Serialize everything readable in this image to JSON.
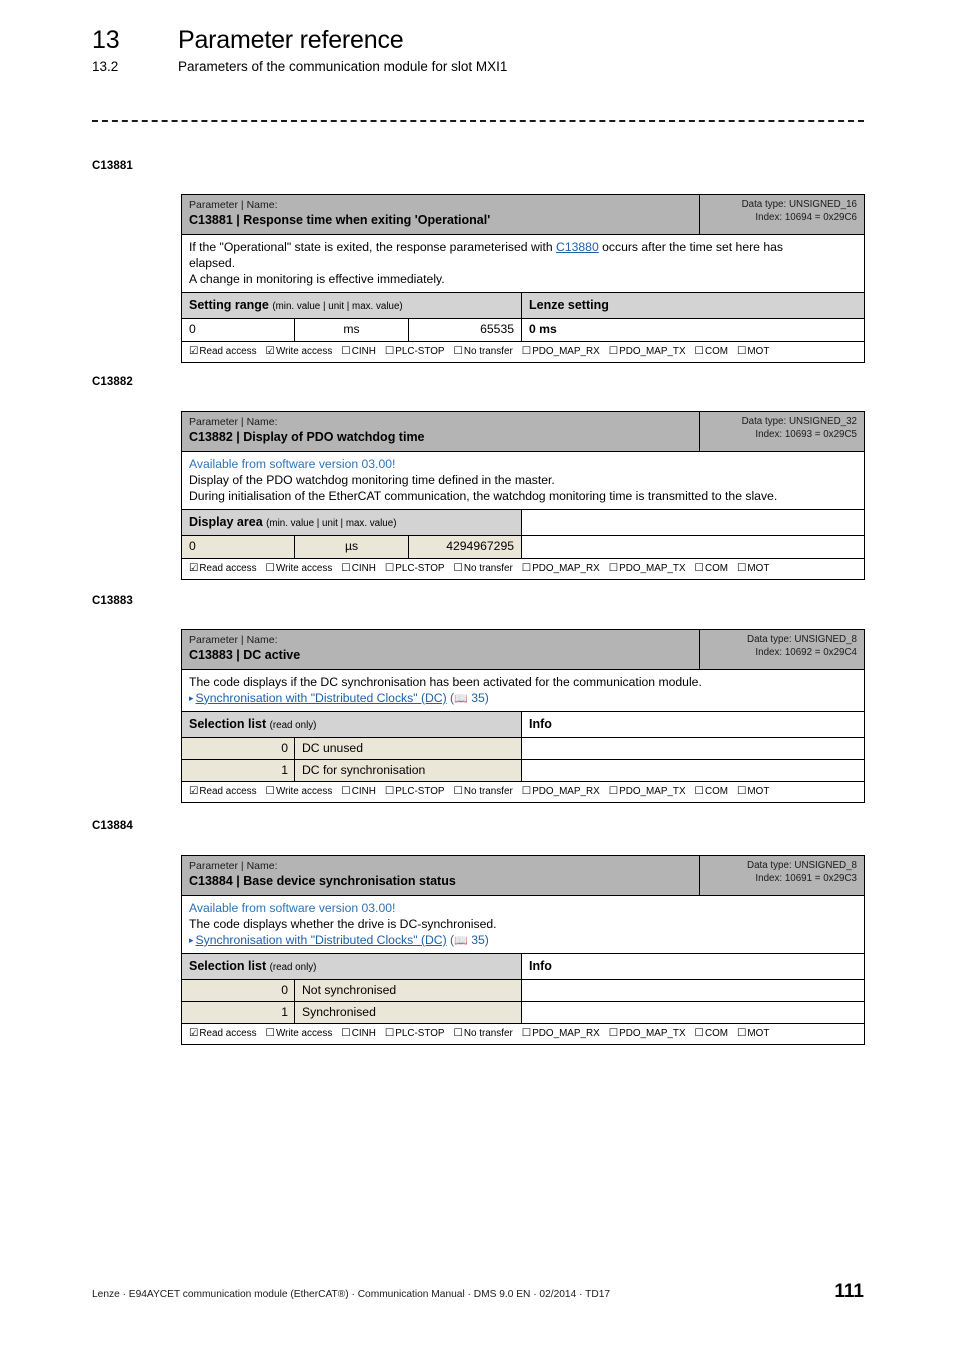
{
  "header": {
    "chapter_number": "13",
    "chapter_title": "Parameter reference",
    "section_number": "13.2",
    "section_title": "Parameters of the communication module for slot MXI1"
  },
  "flag_labels": {
    "read": "Read access",
    "write": "Write access",
    "cinh": "CINH",
    "plc_stop": "PLC-STOP",
    "no_transfer": "No transfer",
    "pdo_map_rx": "PDO_MAP_RX",
    "pdo_map_tx": "PDO_MAP_TX",
    "com": "COM",
    "mot": "MOT"
  },
  "checkbox_glyphs": {
    "checked": "☑",
    "unchecked": "☐"
  },
  "params": [
    {
      "code": "C13881",
      "title_kicker": "Parameter | Name:",
      "title_main": "C13881 | Response time when exiting 'Operational'",
      "data_type": "Data type: UNSIGNED_16",
      "index": "Index: 10694 = 0x29C6",
      "desc_line1_a": "If the \"Operational\" state is exited, the response parameterised with ",
      "desc_link": "C13880",
      "desc_line1_b": " occurs after the time set here has",
      "desc_line2": "elapsed.",
      "desc_line3": "A change in monitoring is effective immediately.",
      "range_head_left_bold": "Setting range ",
      "range_head_left_small": "(min. value | unit | max. value)",
      "range_head_right": "Lenze setting",
      "range_min": "0",
      "range_unit": "ms",
      "range_max": "65535",
      "lenze_setting": "0 ms",
      "flags": {
        "read": "☑",
        "write": "☑",
        "cinh": "☐",
        "plc_stop": "☐",
        "no_transfer": "☐",
        "pdo_map_rx": "☐",
        "pdo_map_tx": "☐",
        "com": "☐",
        "mot": "☐"
      }
    },
    {
      "code": "C13882",
      "title_kicker": "Parameter | Name:",
      "title_main": "C13882 | Display of PDO watchdog time",
      "data_type": "Data type: UNSIGNED_32",
      "index": "Index: 10693 = 0x29C5",
      "sw_note": "Available from software version 03.00!",
      "desc_line2": "Display of the PDO watchdog monitoring time defined in the master.",
      "desc_line3": "During initialisation of the EtherCAT communication, the watchdog monitoring time is transmitted to the slave.",
      "range_head_left_bold": "Display area ",
      "range_head_left_small": "(min. value | unit | max. value)",
      "range_min": "0",
      "range_unit": "µs",
      "range_max": "4294967295",
      "flags": {
        "read": "☑",
        "write": "☐",
        "cinh": "☐",
        "plc_stop": "☐",
        "no_transfer": "☐",
        "pdo_map_rx": "☐",
        "pdo_map_tx": "☐",
        "com": "☐",
        "mot": "☐"
      }
    },
    {
      "code": "C13883",
      "title_kicker": "Parameter | Name:",
      "title_main": "C13883 | DC active",
      "data_type": "Data type: UNSIGNED_8",
      "index": "Index: 10692 = 0x29C4",
      "desc_line1": "The code displays if the DC synchronisation has been activated for the communication module.",
      "xref_bullet": "▸",
      "xref_text": "Synchronisation with \"Distributed Clocks\" (DC)",
      "xref_book": "📖",
      "xref_page": "35",
      "sel_head_bold": "Selection list ",
      "sel_head_small": "(read only)",
      "sel_head_info": "Info",
      "options": [
        {
          "value": "0",
          "label": "DC unused",
          "info": ""
        },
        {
          "value": "1",
          "label": "DC for synchronisation",
          "info": ""
        }
      ],
      "flags": {
        "read": "☑",
        "write": "☐",
        "cinh": "☐",
        "plc_stop": "☐",
        "no_transfer": "☐",
        "pdo_map_rx": "☐",
        "pdo_map_tx": "☐",
        "com": "☐",
        "mot": "☐"
      }
    },
    {
      "code": "C13884",
      "title_kicker": "Parameter | Name:",
      "title_main": "C13884 | Base device synchronisation status",
      "data_type": "Data type: UNSIGNED_8",
      "index": "Index: 10691 = 0x29C3",
      "sw_note": "Available from software version 03.00!",
      "desc_line1": "The code displays whether the drive is DC-synchronised.",
      "xref_bullet": "▸",
      "xref_text": "Synchronisation with \"Distributed Clocks\" (DC)",
      "xref_book": "📖",
      "xref_page": "35",
      "sel_head_bold": "Selection list ",
      "sel_head_small": "(read only)",
      "sel_head_info": "Info",
      "options": [
        {
          "value": "0",
          "label": "Not synchronised",
          "info": ""
        },
        {
          "value": "1",
          "label": "Synchronised",
          "info": ""
        }
      ],
      "flags": {
        "read": "☑",
        "write": "☐",
        "cinh": "☐",
        "plc_stop": "☐",
        "no_transfer": "☐",
        "pdo_map_rx": "☐",
        "pdo_map_tx": "☐",
        "com": "☐",
        "mot": "☐"
      }
    }
  ],
  "footer": {
    "text": "Lenze · E94AYCET communication module (EtherCAT®) · Communication Manual · DMS 9.0 EN · 02/2014 · TD17",
    "page": "111"
  }
}
